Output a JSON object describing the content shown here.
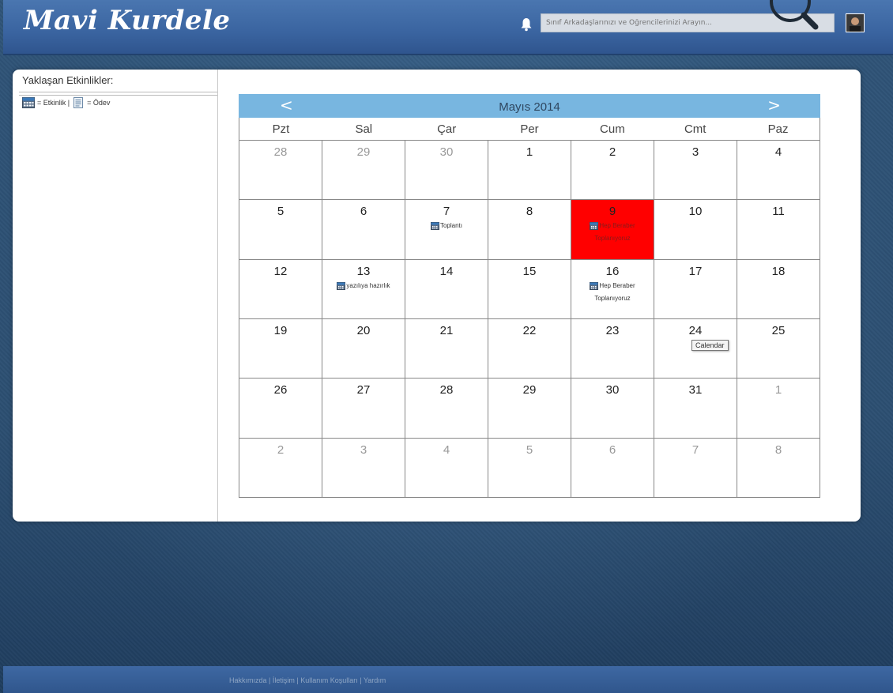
{
  "app": {
    "logo_text": "Mavi Kurdele"
  },
  "header": {
    "search_placeholder": "Sınıf Arkadaşlarınızı ve Öğrencilerinizi Arayın..."
  },
  "sidebar": {
    "title": "Yaklaşan Etkinlikler:",
    "legend_event": "= Etkinlik |",
    "legend_homework": "= Ödev"
  },
  "calendar": {
    "month_title": "Mayıs 2014",
    "prev_label": "<",
    "next_label": ">",
    "weekdays": [
      "Pzt",
      "Sal",
      "Çar",
      "Per",
      "Cum",
      "Cmt",
      "Paz"
    ],
    "weeks": [
      [
        {
          "d": "28",
          "other": true
        },
        {
          "d": "29",
          "other": true
        },
        {
          "d": "30",
          "other": true
        },
        {
          "d": "1"
        },
        {
          "d": "2"
        },
        {
          "d": "3"
        },
        {
          "d": "4"
        }
      ],
      [
        {
          "d": "5"
        },
        {
          "d": "6"
        },
        {
          "d": "7",
          "events": [
            "Toplantı"
          ]
        },
        {
          "d": "8"
        },
        {
          "d": "9",
          "today": true,
          "events": [
            "Hep Beraber Toplanıyoruz"
          ]
        },
        {
          "d": "10"
        },
        {
          "d": "11"
        }
      ],
      [
        {
          "d": "12"
        },
        {
          "d": "13",
          "events": [
            "yazılıya hazırlık"
          ]
        },
        {
          "d": "14"
        },
        {
          "d": "15"
        },
        {
          "d": "16",
          "events": [
            "Hep Beraber Toplanıyoruz"
          ]
        },
        {
          "d": "17"
        },
        {
          "d": "18"
        }
      ],
      [
        {
          "d": "19"
        },
        {
          "d": "20"
        },
        {
          "d": "21"
        },
        {
          "d": "22"
        },
        {
          "d": "23"
        },
        {
          "d": "24"
        },
        {
          "d": "25"
        }
      ],
      [
        {
          "d": "26"
        },
        {
          "d": "27"
        },
        {
          "d": "28"
        },
        {
          "d": "29"
        },
        {
          "d": "30"
        },
        {
          "d": "31"
        },
        {
          "d": "1",
          "other": true
        }
      ],
      [
        {
          "d": "2",
          "other": true
        },
        {
          "d": "3",
          "other": true
        },
        {
          "d": "4",
          "other": true
        },
        {
          "d": "5",
          "other": true
        },
        {
          "d": "6",
          "other": true
        },
        {
          "d": "7",
          "other": true
        },
        {
          "d": "8",
          "other": true
        }
      ]
    ],
    "tooltip": "Calendar",
    "today_color": "#ff0000",
    "header_color": "#78b6e0"
  },
  "footer": {
    "links": [
      "Hakkımızda",
      "İletişim",
      "Kullanım Koşulları",
      "Yardım"
    ],
    "separator": " | "
  }
}
